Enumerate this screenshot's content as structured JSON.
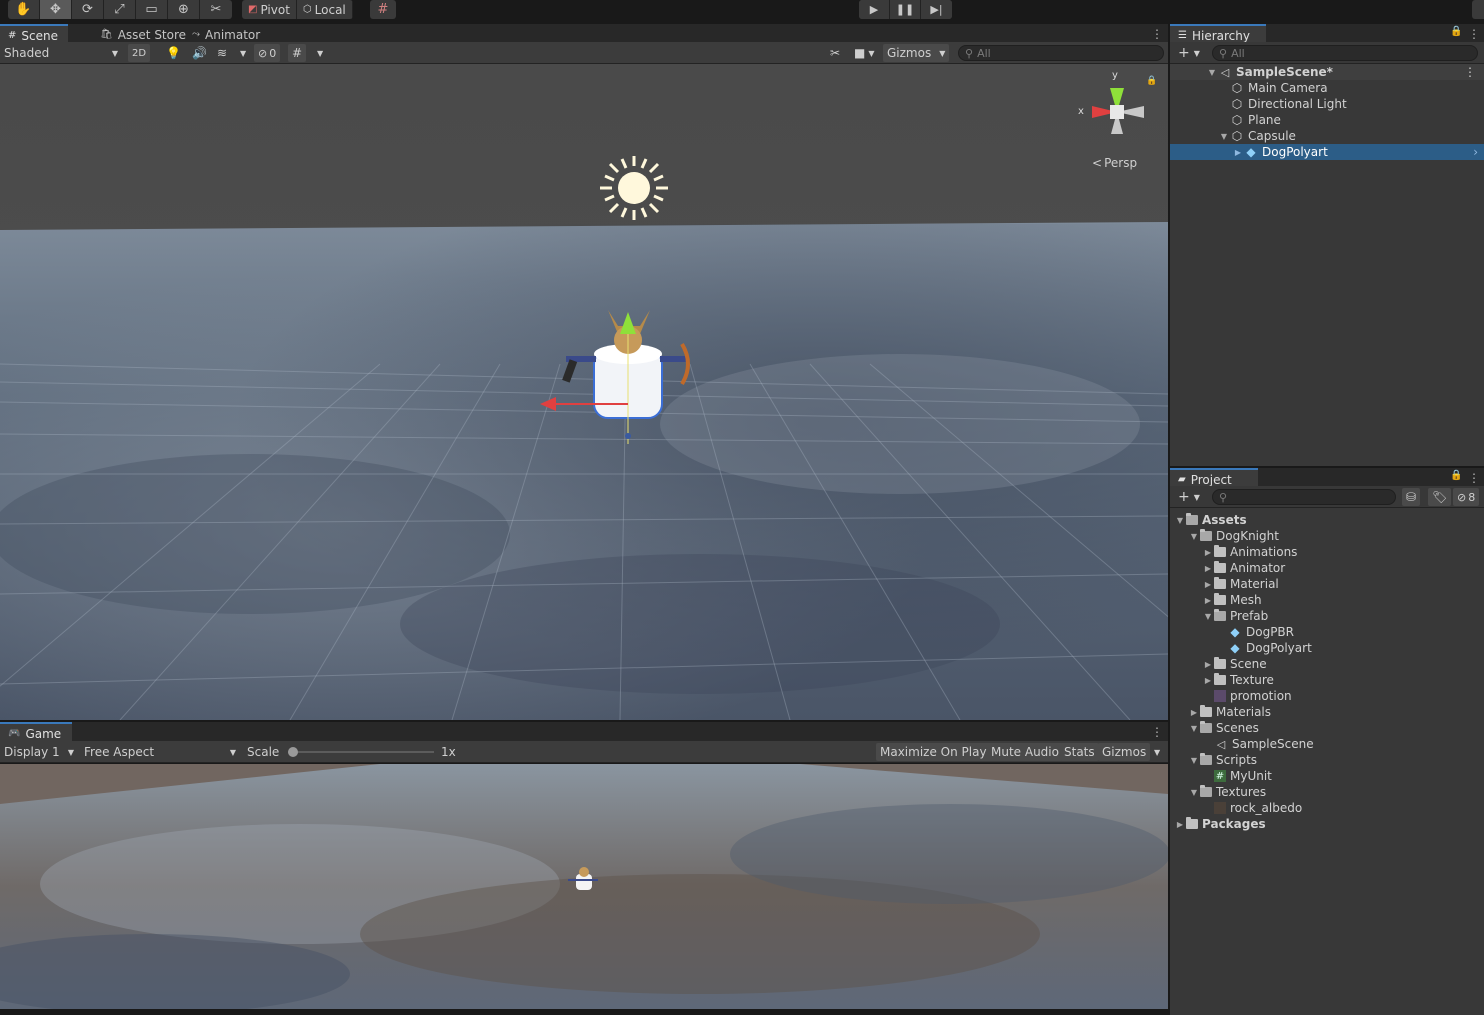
{
  "toolbar": {
    "tools": [
      "hand-tool",
      "move-tool",
      "rotate-tool",
      "scale-tool",
      "rect-tool",
      "transform-tool",
      "custom-tool"
    ],
    "pivot_label": "Pivot",
    "local_label": "Local"
  },
  "scene": {
    "tabs": [
      "Scene",
      "Asset Store",
      "Animator"
    ],
    "shading_mode": "Shaded",
    "mode_2d_label": "2D",
    "hidden_count": "0",
    "gizmos_label": "Gizmos",
    "search_placeholder": "All",
    "persp_label": "Persp",
    "axis_x": "x",
    "axis_y": "y"
  },
  "game": {
    "tab": "Game",
    "display": "Display 1",
    "aspect": "Free Aspect",
    "scale_label": "Scale",
    "scale_value": 0.0,
    "scale_readout": "1x",
    "maximize_label": "Maximize On Play",
    "mute_label": "Mute Audio",
    "stats_label": "Stats",
    "gizmos_label": "Gizmos"
  },
  "hierarchy": {
    "tab": "Hierarchy",
    "search_placeholder": "All",
    "items": [
      {
        "label": "SampleScene*",
        "indent": 0
      },
      {
        "label": "Main Camera",
        "indent": 1
      },
      {
        "label": "Directional Light",
        "indent": 1
      },
      {
        "label": "Plane",
        "indent": 1
      },
      {
        "label": "Capsule",
        "indent": 1
      },
      {
        "label": "DogPolyart",
        "indent": 2
      }
    ]
  },
  "project": {
    "tab": "Project",
    "hidden_count": "8",
    "items": [
      {
        "label": "Assets"
      },
      {
        "label": "DogKnight"
      },
      {
        "label": "Animations"
      },
      {
        "label": "Animator"
      },
      {
        "label": "Material"
      },
      {
        "label": "Mesh"
      },
      {
        "label": "Prefab"
      },
      {
        "label": "DogPBR"
      },
      {
        "label": "DogPolyart"
      },
      {
        "label": "Scene"
      },
      {
        "label": "Texture"
      },
      {
        "label": "promotion"
      },
      {
        "label": "Materials"
      },
      {
        "label": "Scenes"
      },
      {
        "label": "SampleScene"
      },
      {
        "label": "Scripts"
      },
      {
        "label": "MyUnit"
      },
      {
        "label": "Textures"
      },
      {
        "label": "rock_albedo"
      },
      {
        "label": "Packages"
      }
    ]
  },
  "colors": {
    "selection": "#2c5d87",
    "tab_accent": "#3a79bb",
    "panel_bg": "#383838"
  }
}
